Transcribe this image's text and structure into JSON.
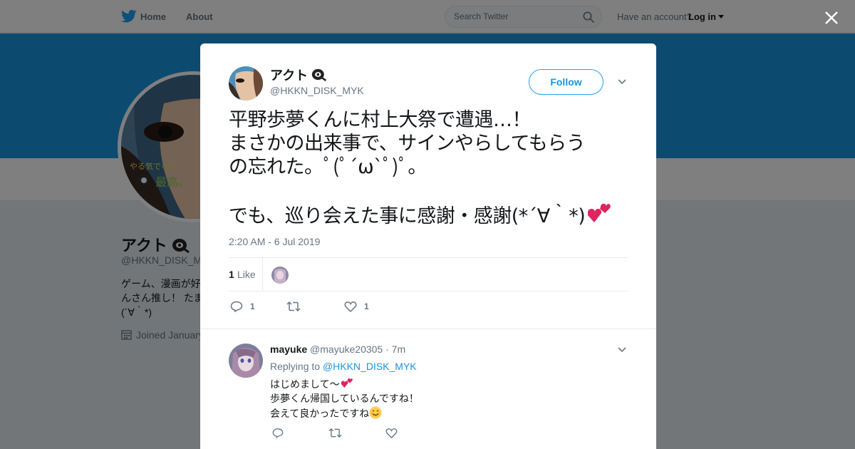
{
  "nav": {
    "home": "Home",
    "about": "About",
    "search_placeholder": "Search Twitter",
    "account_prompt": "Have an account?",
    "login": "Log in",
    "brand_color": "#1da1f2"
  },
  "profile": {
    "name": "アクト",
    "handle": "@HKKN_DISK_MYK",
    "bio": "ゲーム、漫画が好\nんさん推し！ たま\n(´∀｀*)",
    "joined": "Joined January",
    "banner_color": "#1b95e0"
  },
  "tweet": {
    "author_name": "アクト",
    "author_handle": "@HKKN_DISK_MYK",
    "follow_label": "Follow",
    "text": "平野歩夢くんに村上大祭で遭遇…！\nまさかの出来事で、サインやらしてもらう\nの忘れた。ﾟ(ﾟ´ω`ﾟ)ﾟ。\n\nでも、巡り会えた事に感謝・感謝(*´∀｀*)",
    "timestamp": "2:20 AM - 6 Jul 2019",
    "like_count": "1",
    "like_label": "Like",
    "actions": {
      "reply_count": "1",
      "retweet_count": "",
      "like_count": "1"
    }
  },
  "reply": {
    "name": "mayuke",
    "handle": "@mayuke20305",
    "separator": "·",
    "time": "7m",
    "replying_prefix": "Replying to",
    "replying_to": "@HKKN_DISK_MYK",
    "line1": "はじめまして〜",
    "line2": "歩夢くん帰国しているんですね！",
    "line3": "会えて良かったですね"
  }
}
